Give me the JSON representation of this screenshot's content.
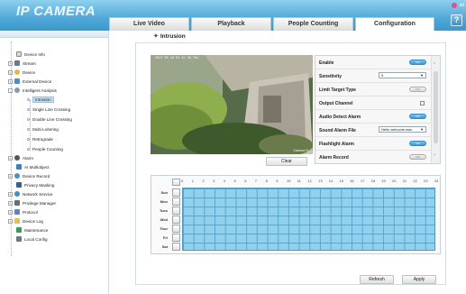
{
  "app": {
    "logo": "IP CAMERA",
    "user": "ad"
  },
  "tabs": [
    {
      "label": "Live Video"
    },
    {
      "label": "Playback"
    },
    {
      "label": "People Counting"
    },
    {
      "label": "Configuration",
      "active": true
    }
  ],
  "sidebar": {
    "items": [
      {
        "label": "Device Info",
        "icon": "document-icon"
      },
      {
        "label": "Stream",
        "icon": "stream-icon"
      },
      {
        "label": "Device",
        "icon": "device-icon"
      },
      {
        "label": "External Device",
        "icon": "external-device-icon"
      },
      {
        "label": "Intelligent Analysis",
        "icon": "analysis-icon"
      },
      {
        "label": "Intrusion",
        "selected": true
      },
      {
        "label": "Single Line Crossing"
      },
      {
        "label": "Double Line Crossing"
      },
      {
        "label": "Multi-Loitering"
      },
      {
        "label": "Retrograde"
      },
      {
        "label": "People Counting"
      },
      {
        "label": "Alarm",
        "icon": "alarm-icon"
      },
      {
        "label": "AI Multiobject",
        "icon": "ai-icon"
      },
      {
        "label": "Device Record",
        "icon": "record-icon"
      },
      {
        "label": "Privacy Masking",
        "icon": "mask-icon"
      },
      {
        "label": "Network Service",
        "icon": "network-icon"
      },
      {
        "label": "Privilege Manager",
        "icon": "users-icon"
      },
      {
        "label": "Protocol",
        "icon": "protocol-icon"
      },
      {
        "label": "Device Log",
        "icon": "log-icon"
      },
      {
        "label": "Maintenance",
        "icon": "maintenance-icon"
      },
      {
        "label": "Local Config",
        "icon": "local-config-icon"
      }
    ]
  },
  "page": {
    "title": "Intrusion"
  },
  "video": {
    "timestamp": "2017 05 16 03 41 38 Thu",
    "channel": "Camera 01"
  },
  "clear_label": "Clear",
  "settings": {
    "enable": {
      "label": "Enable",
      "state": "ON"
    },
    "sensitivity": {
      "label": "Sensitivity",
      "value": "5"
    },
    "limit_target_type": {
      "label": "Limit Target Type",
      "state": "OFF"
    },
    "output_channel": {
      "label": "Output Channel"
    },
    "audio_detect_alarm": {
      "label": "Audio Detect Alarm",
      "state": "ON"
    },
    "sound_alarm_file": {
      "label": "Sound Alarm File",
      "value": "Hello welcome.wav"
    },
    "flashlight_alarm": {
      "label": "Flashlight Alarm",
      "state": "ON"
    },
    "alarm_record": {
      "label": "Alarm Record",
      "state": "OFF"
    }
  },
  "schedule": {
    "hours": [
      "0",
      "1",
      "2",
      "3",
      "4",
      "5",
      "6",
      "7",
      "8",
      "9",
      "10",
      "11",
      "12",
      "13",
      "14",
      "15",
      "16",
      "17",
      "18",
      "19",
      "20",
      "21",
      "22",
      "23",
      "24"
    ],
    "days": [
      "Sun",
      "Mon",
      "Tues",
      "Wed",
      "Thur",
      "Fri",
      "Sat"
    ]
  },
  "buttons": {
    "refresh": "Refresh",
    "apply": "Apply"
  },
  "colors": {
    "header": "#4fa8d8",
    "grid": "#8fd1ee",
    "accent": "#3a97d2"
  }
}
